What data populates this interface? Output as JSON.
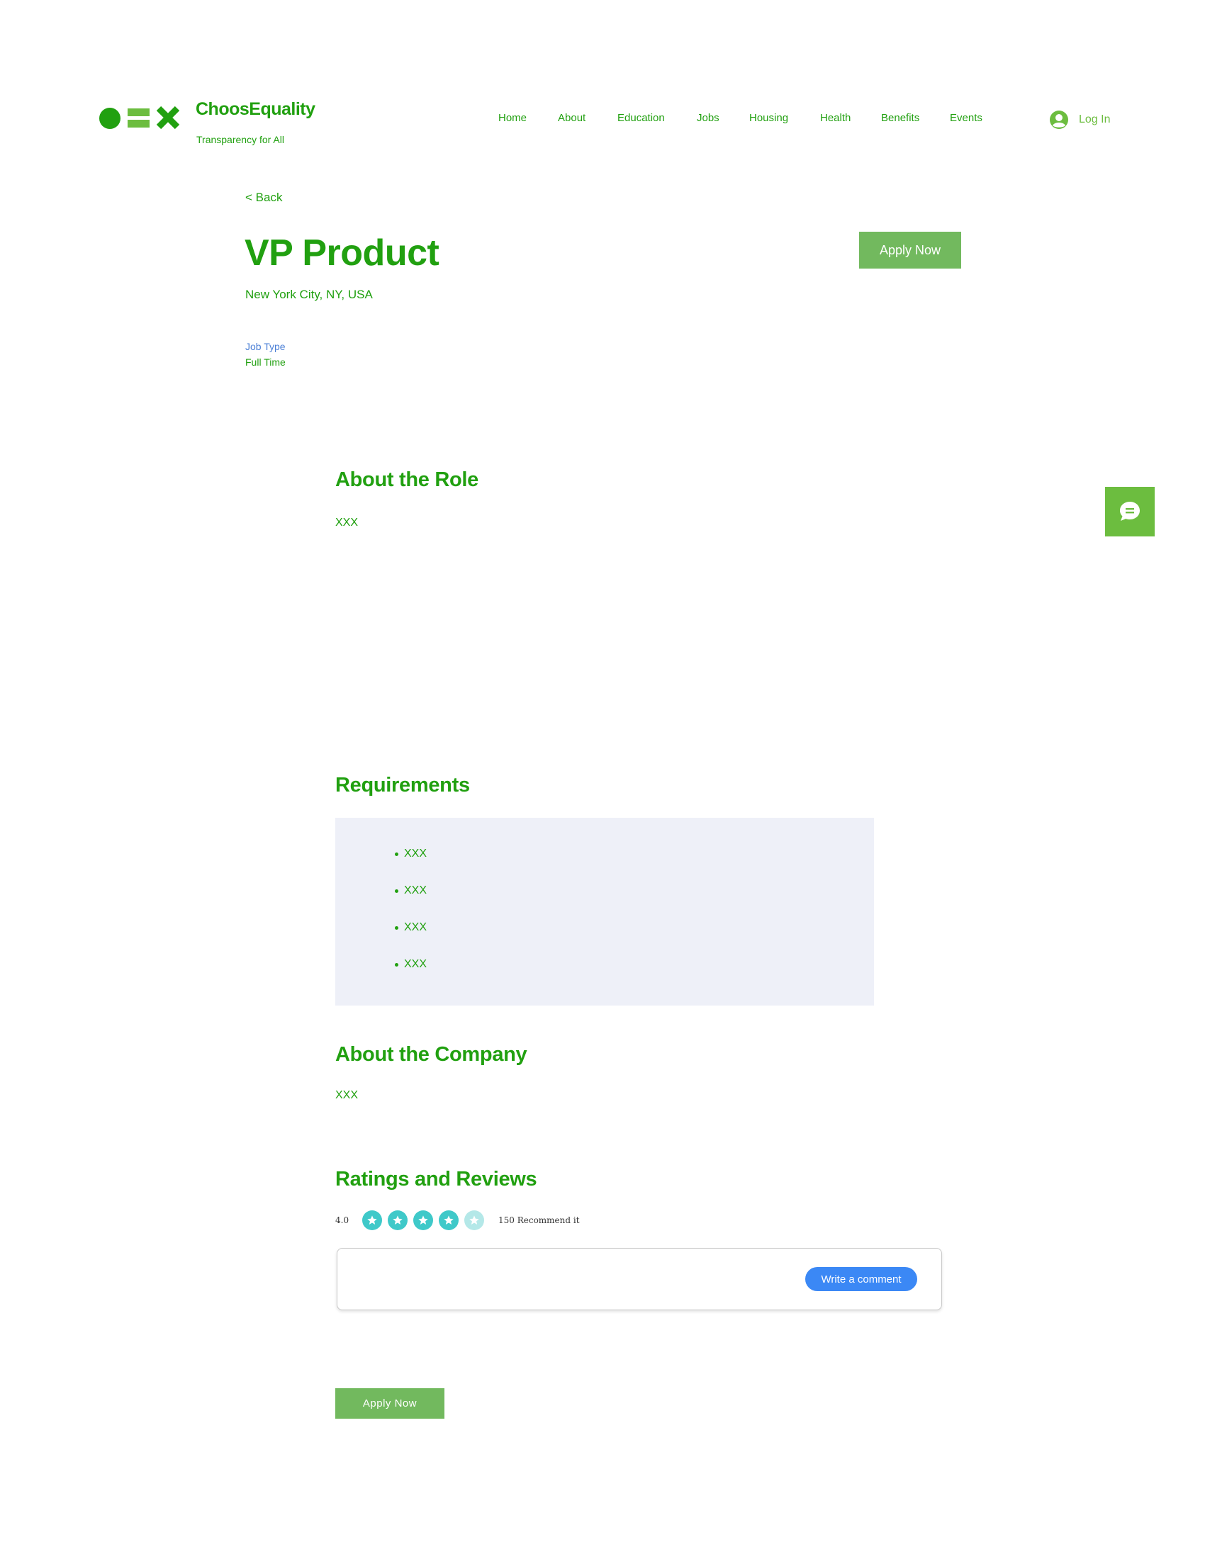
{
  "header": {
    "brand_name": "ChoosEquality",
    "brand_tagline": "Transparency for All",
    "nav": [
      "Home",
      "About",
      "Education",
      "Jobs",
      "Housing",
      "Health",
      "Benefits",
      "Events"
    ],
    "login_label": "Log In"
  },
  "job": {
    "back_label": "< Back",
    "title": "VP Product",
    "location": "New York City, NY, USA",
    "apply_label": "Apply Now",
    "job_type_label": "Job Type",
    "job_type_value": "Full Time"
  },
  "about_role": {
    "title": "About the Role",
    "text": "XXX"
  },
  "requirements": {
    "title": "Requirements",
    "items": [
      "XXX",
      "XXX",
      "XXX",
      "XXX"
    ]
  },
  "about_company": {
    "title": "About the Company",
    "text": "XXX"
  },
  "ratings": {
    "title": "Ratings and Reviews",
    "score": "4.0",
    "stars_filled": 4,
    "stars_total": 5,
    "recommend_text": "150 Recommend it",
    "write_comment_label": "Write a comment"
  },
  "footer_apply_label": "Apply Now",
  "icons": {
    "logo": [
      "circle-icon",
      "equals-icon",
      "x-icon"
    ],
    "login": "user-avatar-icon",
    "chat": "chat-bubble-icon",
    "rating": "star-icon"
  },
  "colors": {
    "brand_green": "#21a010",
    "light_green": "#6cbd3f",
    "button_green": "#72b95e",
    "link_blue": "#4b7fd6",
    "comment_button_blue": "#3b88f5",
    "star_teal": "#3fc9c9",
    "requirements_bg": "#eef0f8"
  }
}
